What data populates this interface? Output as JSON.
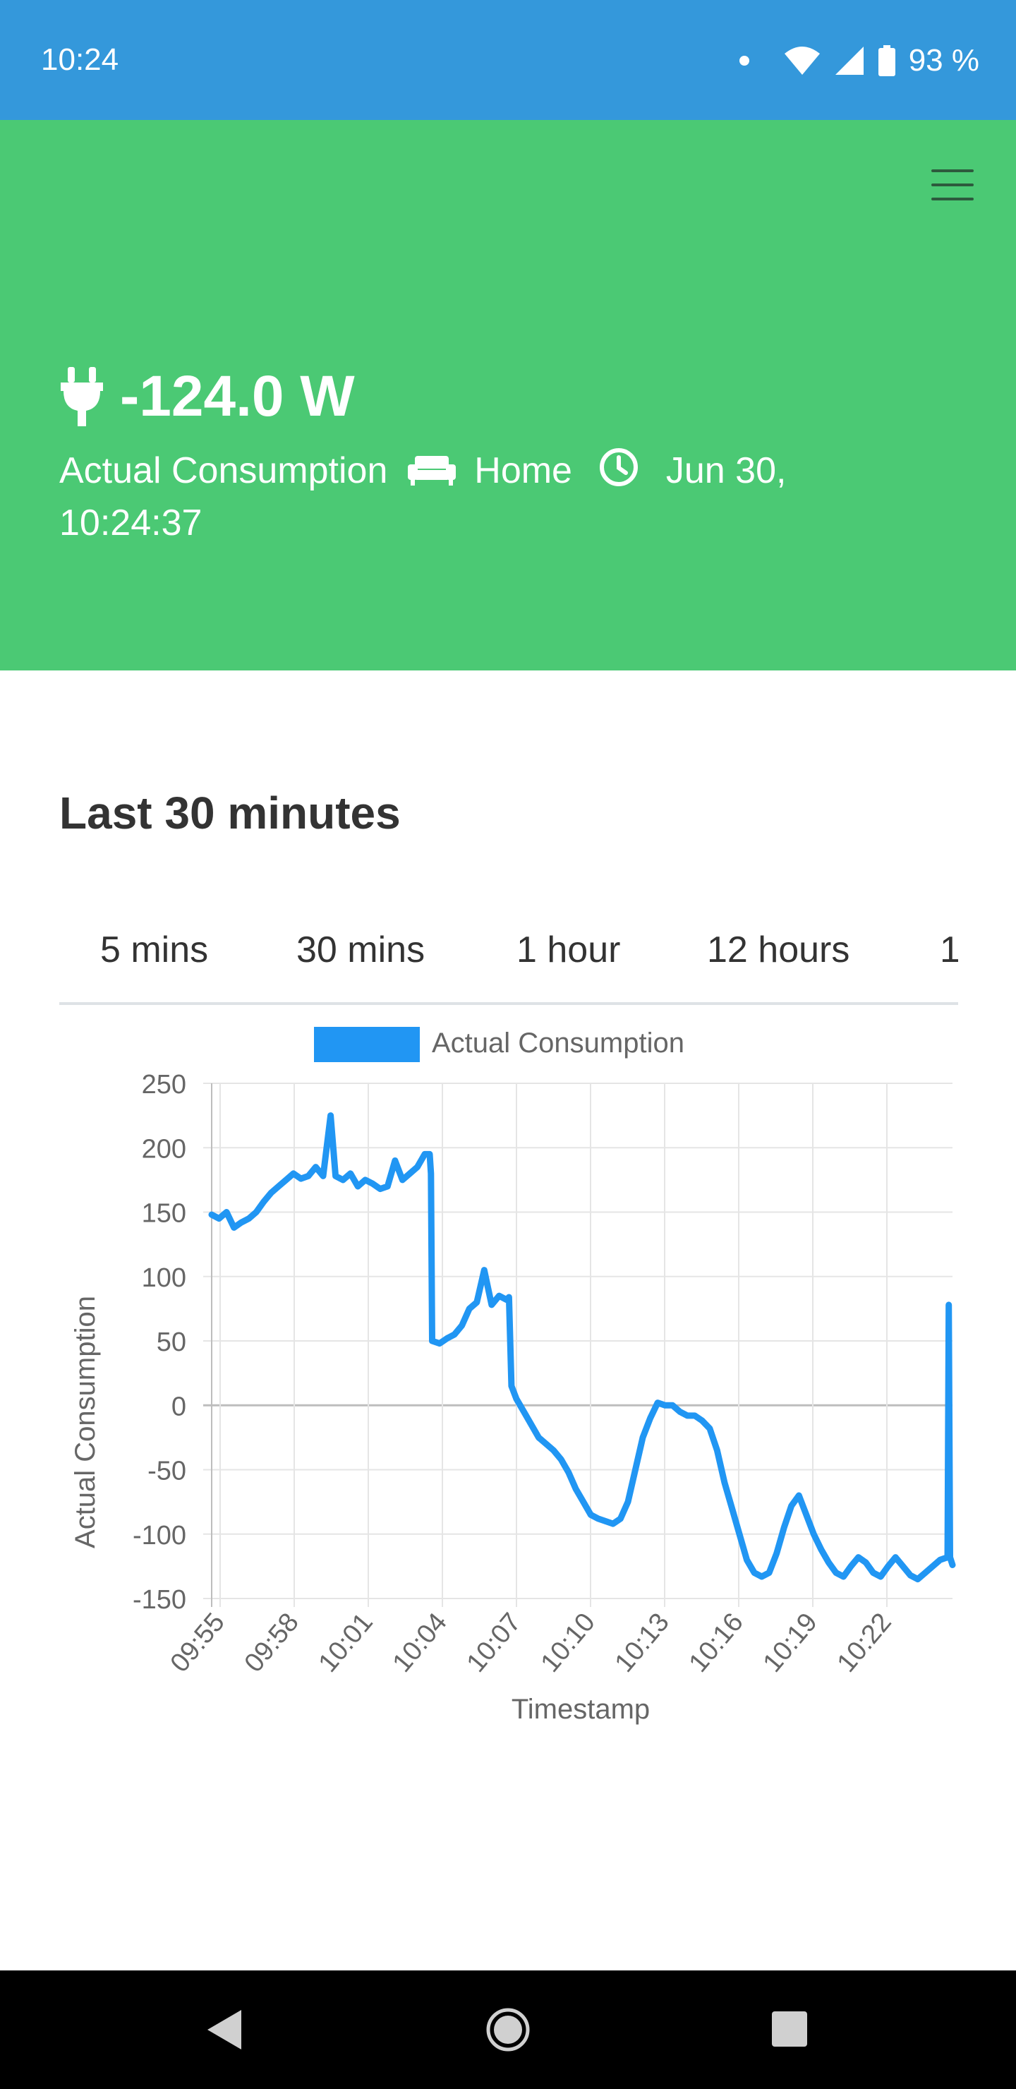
{
  "status": {
    "time": "10:24",
    "battery": "93 %"
  },
  "header": {
    "value": "-124.0 W",
    "metric": "Actual Consumption",
    "location": "Home",
    "timestamp": "Jun 30, 10:24:37"
  },
  "section_title": "Last 30 minutes",
  "tabs": [
    "5 mins",
    "30 mins",
    "1 hour",
    "12 hours",
    "1"
  ],
  "colors": {
    "status_bar": "#3498db",
    "header_bg": "#4bc974",
    "series": "#2196f3"
  },
  "chart_data": {
    "type": "line",
    "legend": "Actual Consumption",
    "xlabel": "Timestamp",
    "ylabel": "Actual Consumption",
    "ylim": [
      -150,
      250
    ],
    "yticks": [
      250,
      200,
      150,
      100,
      50,
      0,
      -50,
      -100,
      -150
    ],
    "xticks": [
      "09:55",
      "09:58",
      "10:01",
      "10:04",
      "10:07",
      "10:10",
      "10:13",
      "10:16",
      "10:19",
      "10:22"
    ],
    "series": [
      {
        "name": "Actual Consumption",
        "x": [
          0.0,
          0.3,
          0.6,
          0.9,
          1.2,
          1.5,
          1.8,
          2.1,
          2.4,
          2.7,
          3.0,
          3.3,
          3.6,
          3.9,
          4.2,
          4.5,
          4.8,
          5.0,
          5.3,
          5.6,
          5.9,
          6.2,
          6.5,
          6.8,
          7.1,
          7.4,
          7.7,
          8.0,
          8.3,
          8.6,
          8.8,
          8.85,
          8.9,
          9.2,
          9.5,
          9.8,
          10.1,
          10.4,
          10.7,
          11.0,
          11.3,
          11.6,
          11.9,
          12.0,
          12.1,
          12.3,
          12.6,
          12.9,
          13.2,
          13.5,
          13.8,
          14.1,
          14.4,
          14.7,
          15.0,
          15.3,
          15.6,
          15.9,
          16.2,
          16.5,
          16.8,
          17.1,
          17.4,
          17.7,
          18.0,
          18.3,
          18.6,
          18.9,
          19.2,
          19.5,
          19.8,
          20.1,
          20.4,
          20.7,
          21.0,
          21.3,
          21.6,
          21.9,
          22.2,
          22.5,
          22.8,
          23.1,
          23.4,
          23.7,
          24.0,
          24.3,
          24.6,
          24.9,
          25.2,
          25.5,
          25.8,
          26.1,
          26.4,
          26.7,
          27.0,
          27.3,
          27.6,
          27.9,
          28.2,
          28.5,
          28.8,
          29.1,
          29.4,
          29.7,
          29.75,
          29.8,
          29.9
        ],
        "values": [
          148,
          145,
          150,
          138,
          142,
          145,
          150,
          158,
          165,
          170,
          175,
          180,
          176,
          178,
          185,
          178,
          225,
          178,
          175,
          180,
          170,
          175,
          172,
          168,
          170,
          190,
          175,
          180,
          185,
          195,
          195,
          180,
          50,
          48,
          52,
          55,
          62,
          75,
          80,
          105,
          78,
          85,
          82,
          84,
          15,
          5,
          -5,
          -15,
          -25,
          -30,
          -35,
          -42,
          -52,
          -65,
          -75,
          -85,
          -88,
          -90,
          -92,
          -88,
          -75,
          -50,
          -25,
          -10,
          2,
          0,
          0,
          -5,
          -8,
          -8,
          -12,
          -18,
          -35,
          -60,
          -80,
          -100,
          -120,
          -130,
          -133,
          -130,
          -115,
          -95,
          -78,
          -70,
          -85,
          -100,
          -112,
          -122,
          -130,
          -133,
          -125,
          -118,
          -122,
          -130,
          -133,
          -125,
          -118,
          -125,
          -132,
          -135,
          -130,
          -125,
          -120,
          -118,
          78,
          -118,
          -124
        ]
      }
    ]
  }
}
